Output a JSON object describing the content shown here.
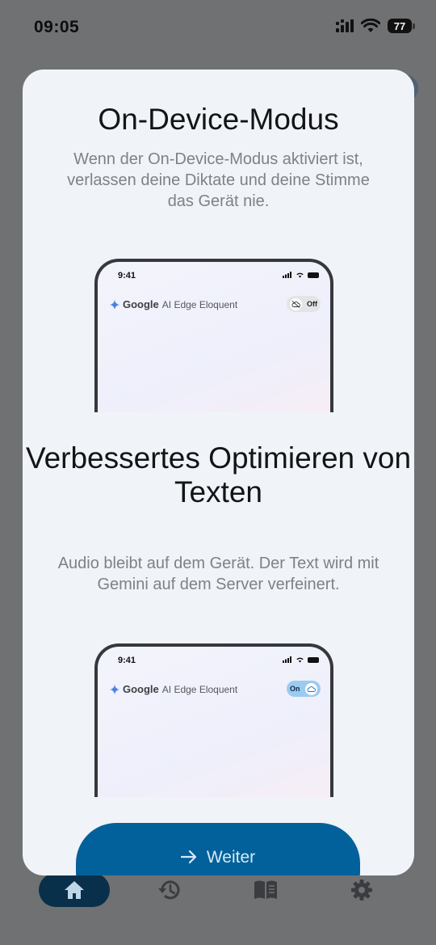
{
  "status_bar": {
    "time": "09:05",
    "battery": "77",
    "icons": [
      "signal-icon",
      "wifi-icon",
      "battery-icon"
    ]
  },
  "bottom_nav": {
    "items": [
      {
        "icon": "home-icon",
        "active": true
      },
      {
        "icon": "history-icon",
        "active": false
      },
      {
        "icon": "book-icon",
        "active": false
      },
      {
        "icon": "gear-icon",
        "active": false
      }
    ]
  },
  "modal": {
    "sections": [
      {
        "title": "On-Device-Modus",
        "description": "Wenn der On-Device-Modus aktiviert ist, verlassen deine Diktate und deine Stimme das Gerät nie.",
        "preview": {
          "time": "9:41",
          "brand_google": "Google",
          "brand_product": "AI Edge Eloquent",
          "toggle_label": "Off",
          "toggle_icon": "cloud-off-icon"
        }
      },
      {
        "title": "Verbessertes Optimieren von Texten",
        "description": "Audio bleibt auf dem Gerät. Der Text wird mit Gemini auf dem Server verfeinert.",
        "preview": {
          "time": "9:41",
          "brand_google": "Google",
          "brand_product": "AI Edge Eloquent",
          "toggle_label": "On",
          "toggle_icon": "cloud-icon"
        }
      }
    ],
    "continue_button": {
      "label": "Weiter",
      "icon": "arrow-right-icon"
    }
  },
  "colors": {
    "overlay": "#707173",
    "modal_bg": "#f0f3f8",
    "primary": "#02619a",
    "nav_active": "#09304a",
    "toggle_on": "#9ccbf0"
  }
}
